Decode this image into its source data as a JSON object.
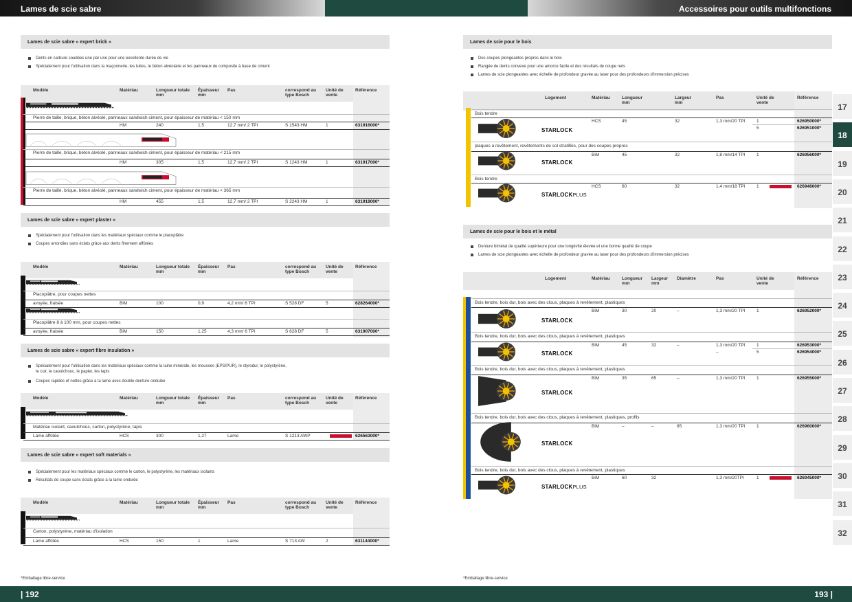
{
  "header": {
    "left_title": "Lames de scie sabre",
    "right_title": "Accessoires pour outils multifonctions"
  },
  "left_sections": [
    {
      "title": "Lames de scie sabre « expert brick »",
      "bullets": [
        "Dents en carbure soudées une par une pour une excellente durée de vie",
        "Spécialement pour l'utilisation dans la maçonnerie, les tuiles, le béton alvéolaire et les panneaux de composite à base de ciment"
      ],
      "columns": [
        "Modèle",
        "Matériau",
        "Longueur totale\nmm",
        "Épaisseur\nmm",
        "Pas",
        "correspond au\ntype Bosch",
        "Unité de\nvente",
        "Référence"
      ],
      "rows": [
        {
          "desc": "Pierre de taille, brique, béton alvéolé, panneaux sandwich ciment, pour épaisseur de matériau < 150 mm",
          "cells": [
            "",
            "HM",
            "240",
            "1,5",
            "12,7 mm/ 2 TPI",
            "S 1543 HM",
            "1",
            "631916000*"
          ]
        },
        {
          "desc": "Pierre de taille, brique, béton alvéolé, panneaux sandwich ciment, pour épaisseur de matériau < 215 mm",
          "cells": [
            "",
            "HM",
            "305",
            "1,5",
            "12,7 mm/ 2 TPI",
            "S 1243 HM",
            "1",
            "631917000*"
          ]
        },
        {
          "desc": "Pierre de taille, brique, béton alvéolé, panneaux sandwich ciment, pour épaisseur de matériau < 365 mm",
          "cells": [
            "",
            "HM",
            "455",
            "1,5",
            "12,7 mm/ 2 TPI",
            "S 2243 HM",
            "1",
            "631918000*"
          ]
        }
      ]
    },
    {
      "title": "Lames de scie sabre « expert plaster »",
      "bullets": [
        "Spécialement pour l'utilisation dans les matériaux spéciaux comme le placoplâtre",
        "Coupes arrondies sans éclats grâce aux dents finement affûtées"
      ],
      "columns": [
        "Modèle",
        "Matériau",
        "Longueur totale\nmm",
        "Épaisseur\nmm",
        "Pas",
        "correspond au\ntype Bosch",
        "Unité de\nvente",
        "Référence"
      ],
      "rows": [
        {
          "desc": "Placoplâtre, pour coupes nettes",
          "cells": [
            "avoyée, fraisée",
            "BiM",
            "100",
            "0,9",
            "4,2 mm/ 6 TPI",
            "S 528 DF",
            "5",
            "628264000*"
          ]
        },
        {
          "desc": "Placoplâtre 8 à 100 mm, pour coupes nettes",
          "cells": [
            "avoyée, fraisée",
            "BiM",
            "150",
            "1,25",
            "4,3 mm/ 6 TPI",
            "S 628 DF",
            "5",
            "631907000*"
          ]
        }
      ]
    },
    {
      "title": "Lames de scie sabre « expert fibre insulation »",
      "bullets": [
        "Spécialement pour l'utilisation dans les matériaux spéciaux comme la laine minérale, les mousses (EPS/PUR), le styrodur, le polystyrène,",
        "le cuir, le caoutchouc, le papier, les tapis",
        "Coupes rapides et nettes grâce à la lame avec double denture ondulée"
      ],
      "columns": [
        "Modèle",
        "Matériau",
        "Longueur totale\nmm",
        "Épaisseur\nmm",
        "Pas",
        "correspond au\ntype Bosch",
        "Unité de\nvente",
        "Référence"
      ],
      "rows": [
        {
          "desc": "Matériau isolant, caoutchouc, carton, polystyrène, tapis",
          "cells": [
            "Lame affûtée",
            "HCS",
            "300",
            "1,27",
            "Lame",
            "S 1213 AWP",
            "NOUVEAU",
            "626563000*"
          ]
        }
      ]
    },
    {
      "title": "Lames de scie sabre « expert soft materials »",
      "bullets": [
        "Spécialement pour les matériaux spéciaux comme le carton, le polystyrène, les matériaux isolants",
        "Résultats de coupe sans éclats grâce à la lame ondulée"
      ],
      "columns": [
        "Modèle",
        "Matériau",
        "Longueur totale\nmm",
        "Épaisseur\nmm",
        "Pas",
        "correspond au\ntype Bosch",
        "Unité de\nvente",
        "Référence"
      ],
      "rows": [
        {
          "desc": "Carton, polystyrène, matériau d'isolation",
          "cells": [
            "Lame affûtée",
            "HCS",
            "150",
            "1",
            "Lame",
            "S 713 AW",
            "2",
            "631144000*"
          ]
        }
      ]
    }
  ],
  "right_sections": [
    {
      "title": "Lames de scie pour le bois",
      "bullets": [
        "Des coupes plongeantes propres dans le bois",
        "Rangée de dents convexe pour une amorce facile et des résultats de coupe nets",
        "Lames de scie plongeantes avec échelle de profondeur gravée au laser pour des profondeurs d'immersion précises"
      ],
      "columns": [
        "Logement",
        "Matériau",
        "Longueur\nmm",
        "Largeur\nmm",
        "Pas",
        "Unité de\nvente",
        "Référence"
      ],
      "rows": [
        {
          "desc": "Bois tendre",
          "logo": "STARLOCK",
          "cells": [
            "HCS",
            "45",
            "32",
            "1,3 mm/20 TPI",
            "1",
            "626950000*"
          ],
          "extra": [
            "5",
            "626951000*"
          ]
        },
        {
          "desc": "plaques à revêtement, revêtements de sol stratifiés, pour des coupes propres",
          "logo": "STARLOCK",
          "cells": [
            "BiM",
            "45",
            "32",
            "1,8 mm/14 TPI",
            "1",
            "626956000*"
          ]
        },
        {
          "desc": "Bois tendre",
          "logo": "STARLOCK",
          "logo_plus": "PLUS",
          "cells": [
            "HCS",
            "60",
            "32",
            "1,4 mm/18 TPI",
            "1",
            "626946000*"
          ],
          "badge": "NOUVEAU"
        }
      ]
    },
    {
      "title": "Lames de scie pour le bois et le métal",
      "bullets": [
        "Denture bimétal de qualité supérieure pour une longévité élevée et une bonne qualité de coupe",
        "Lames de scie plongeantes avec échelle de profondeur gravée au laser pour des profondeurs d'immersion précises"
      ],
      "columns": [
        "Logement",
        "Matériau",
        "Longueur\nmm",
        "Largeur\nmm",
        "Diamètre",
        "Pas",
        "Unité de\nvente",
        "Référence"
      ],
      "rows": [
        {
          "desc": "Bois tendre, bois dur, bois avec des clous, plaques à revêtement, plastiques",
          "logo": "STARLOCK",
          "cells": [
            "BiM",
            "30",
            "20",
            "–",
            "1,3 mm/20 TPI",
            "1",
            "626952000*"
          ]
        },
        {
          "desc": "Bois tendre, bois dur, bois avec des clous, plaques à revêtement, plastiques",
          "logo": "STARLOCK",
          "cells": [
            "BiM",
            "45",
            "32",
            "–",
            "1,3 mm/20 TPI",
            "1",
            "626953000*"
          ],
          "extra": [
            "–",
            "5",
            "626954000*"
          ]
        },
        {
          "desc": "Bois tendre, bois dur, bois avec des clous, plaques à revêtement, plastiques",
          "logo": "STARLOCK",
          "cells": [
            "BiM",
            "35",
            "65",
            "–",
            "1,3 mm/20 TPI",
            "1",
            "626955000*"
          ]
        },
        {
          "desc": "Bois tendre, bois dur, bois avec des clous, plaques à revêtement, plastiques, profils",
          "logo": "STARLOCK",
          "cells": [
            "BiM",
            "–",
            "–",
            "85",
            "1,3 mm/20 TPI",
            "1",
            "626960000*"
          ]
        },
        {
          "desc": "Bois tendre, bois dur, bois avec des clous, plaques à revêtement, plastiques",
          "logo": "STARLOCK",
          "logo_plus": "PLUS",
          "cells": [
            "BiM",
            "60",
            "32",
            "",
            "1,3 mm/20TPI",
            "1",
            "626945000*"
          ],
          "badge": "NOUVEAU"
        }
      ]
    }
  ],
  "tabs": [
    "17",
    "18",
    "19",
    "20",
    "21",
    "22",
    "23",
    "24",
    "25",
    "26",
    "27",
    "28",
    "29",
    "30",
    "31",
    "32"
  ],
  "active_tab": "18",
  "footnote_left": "*Emballage libre-service",
  "footnote_right": "*Emballage libre-service",
  "page_left": "| 192",
  "page_right": "193 |",
  "colors": {
    "green": "#1f4a3f",
    "red_stripe": "#c8102e",
    "yellow_stripe": "#f2c400",
    "blue_stripe": "#1f4f9a"
  }
}
